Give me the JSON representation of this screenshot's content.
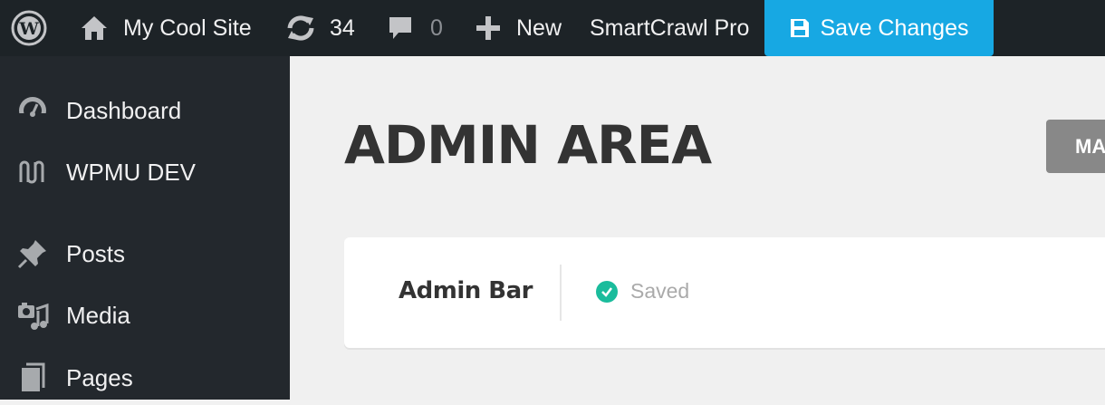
{
  "adminbar": {
    "site_name": "My Cool Site",
    "updates_count": "34",
    "comments_count": "0",
    "new_label": "New",
    "plugin_label": "SmartCrawl Pro",
    "save_label": "Save Changes"
  },
  "sidebar": {
    "items": [
      {
        "label": "Dashboard",
        "icon": "dashboard-icon"
      },
      {
        "label": "WPMU DEV",
        "icon": "wpmu-dev-icon"
      },
      {
        "label": "Posts",
        "icon": "pushpin-icon"
      },
      {
        "label": "Media",
        "icon": "media-icon"
      },
      {
        "label": "Pages",
        "icon": "pages-icon"
      }
    ]
  },
  "main": {
    "title": "ADMIN AREA",
    "header_button_label": "MA",
    "card": {
      "title": "Admin Bar",
      "status": "Saved"
    }
  },
  "colors": {
    "adminbar_bg": "#1d2327",
    "sidebar_bg": "#23282d",
    "save_button": "#17a8e3",
    "status_ok": "#1abc9c"
  }
}
